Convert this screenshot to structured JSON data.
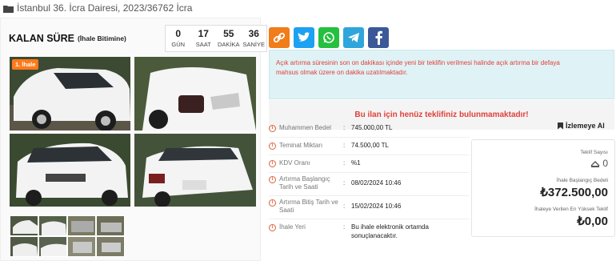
{
  "breadcrumb": {
    "text": "İstanbul 36. İcra Dairesi, 2023/36762 İcra"
  },
  "countdown": {
    "title": "KALAN SÜRE",
    "subtitle": "(İhale Bitimine)",
    "cells": [
      {
        "value": "0",
        "label": "GÜN"
      },
      {
        "value": "17",
        "label": "SAAT"
      },
      {
        "value": "55",
        "label": "DAKİKA"
      },
      {
        "value": "36",
        "label": "SANİYE"
      }
    ]
  },
  "gallery": {
    "badge": "1. İhale"
  },
  "share": [
    {
      "icon": "link-icon",
      "color": "#f07c1a"
    },
    {
      "icon": "twitter-icon",
      "color": "#1da1f2"
    },
    {
      "icon": "whatsapp-icon",
      "color": "#25c03f"
    },
    {
      "icon": "telegram-icon",
      "color": "#2ea6dc"
    },
    {
      "icon": "facebook-icon",
      "color": "#3b5998"
    }
  ],
  "notice": {
    "line1": "Açık artırma süresinin son on dakikası içinde yeni bir teklifin verilmesi halinde açık artırma bir defaya",
    "line2": "mahsus olmak üzere on dakika uzatılmaktadır."
  },
  "no_offer": "Bu ilan için henüz teklifiniz bulunmamaktadır!",
  "details": [
    {
      "label": "Muhammen Bedel",
      "value": "745.000,00 TL"
    },
    {
      "label": "Teminat Miktarı",
      "value": "74.500,00 TL"
    },
    {
      "label": "KDV Oranı",
      "value": "%1"
    },
    {
      "label": "Artırma Başlangıç Tarih ve Saati",
      "value": "08/02/2024 10:46"
    },
    {
      "label": "Artırma Bitiş Tarih ve Saati",
      "value": "15/02/2024 10:46"
    },
    {
      "label": "İhale Yeri",
      "value": "Bu ihale elektronik ortamda sonuçlanacaktır."
    }
  ],
  "watch_label": "İzlemeye Al",
  "summary": {
    "offer_count_label": "Teklif Sayısı",
    "offer_count": "0",
    "start_price_label": "İhale Başlangıç Bedeli",
    "start_price": "₺372.500,00",
    "highest_label": "İhaleye Verilen En Yüksek Teklif",
    "highest": "₺0,00"
  },
  "colors": {
    "accent": "#e0403a",
    "badge": "#ff7a1a"
  }
}
